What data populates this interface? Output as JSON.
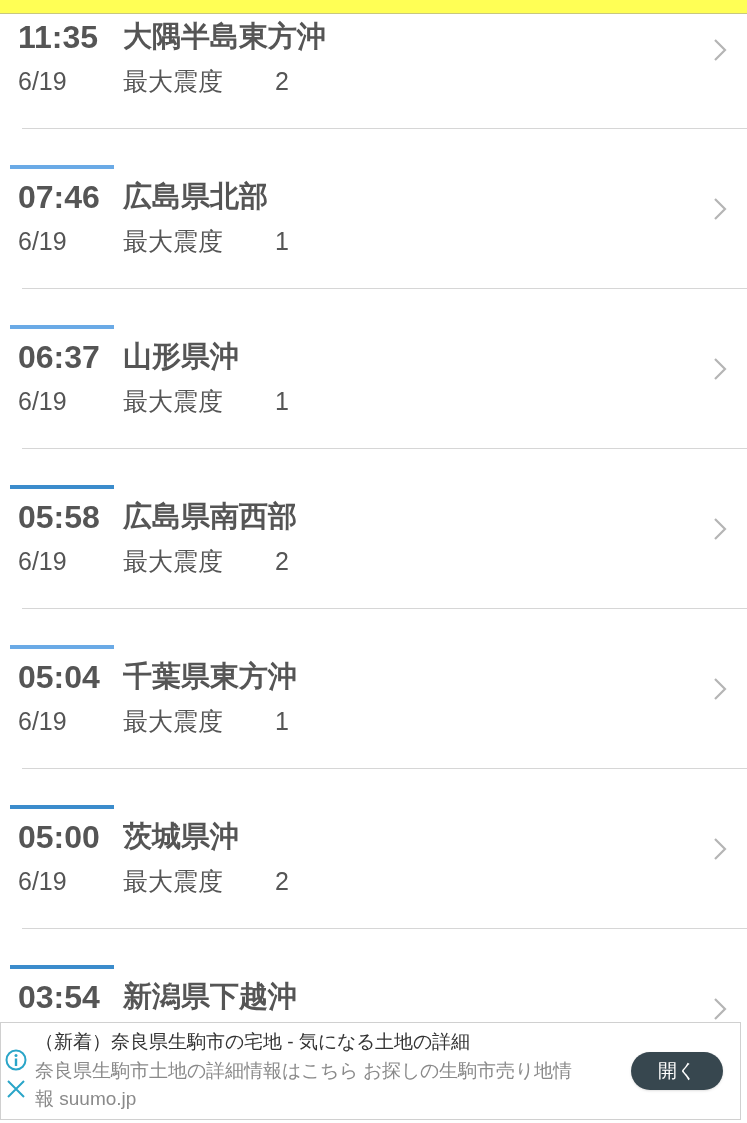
{
  "quakes": [
    {
      "time": "11:35",
      "place": "大隅半島東方沖",
      "date": "6/19",
      "label": "最大震度",
      "intensity": "2"
    },
    {
      "time": "07:46",
      "place": "広島県北部",
      "date": "6/19",
      "label": "最大震度",
      "intensity": "1",
      "color": "#6aaae6"
    },
    {
      "time": "06:37",
      "place": "山形県沖",
      "date": "6/19",
      "label": "最大震度",
      "intensity": "1",
      "color": "#6aaae6"
    },
    {
      "time": "05:58",
      "place": "広島県南西部",
      "date": "6/19",
      "label": "最大震度",
      "intensity": "2",
      "color": "#3b8ccc"
    },
    {
      "time": "05:04",
      "place": "千葉県東方沖",
      "date": "6/19",
      "label": "最大震度",
      "intensity": "1",
      "color": "#6aaae6"
    },
    {
      "time": "05:00",
      "place": "茨城県沖",
      "date": "6/19",
      "label": "最大震度",
      "intensity": "2",
      "color": "#3b8ccc"
    },
    {
      "time": "03:54",
      "place": "新潟県下越沖",
      "color": "#3b8ccc"
    }
  ],
  "ad": {
    "title": "（新着）奈良県生駒市の宅地 - 気になる土地の詳細",
    "body": "奈良県生駒市土地の詳細情報はこちら お探しの生駒市売り地情報 suumo.jp",
    "button": "開く"
  }
}
